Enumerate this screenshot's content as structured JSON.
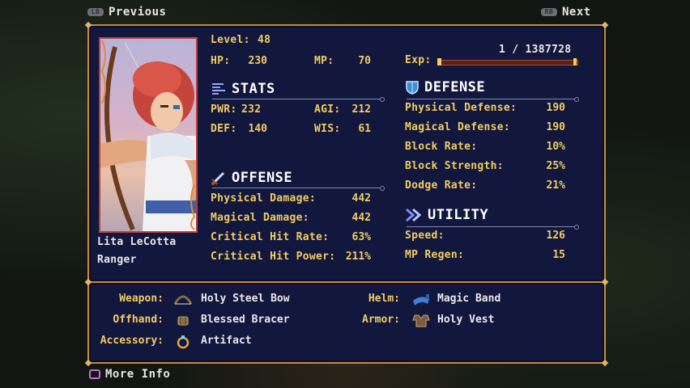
{
  "nav": {
    "prev_label": "Previous",
    "next_label": "Next",
    "prev_glyph": "LB",
    "next_glyph": "RB"
  },
  "character": {
    "name": "Lita LeCotta",
    "class": "Ranger",
    "level_label": "Level:",
    "level": "48",
    "hp_label": "HP:",
    "hp": "230",
    "mp_label": "MP:",
    "mp": "70",
    "exp_label": "Exp:",
    "exp": "1 / 1387728",
    "exp_fraction": 0.0
  },
  "stats": {
    "title": "STATS",
    "items": [
      {
        "label": "PWR:",
        "value": "232"
      },
      {
        "label": "AGI:",
        "value": "212"
      },
      {
        "label": "DEF:",
        "value": "140"
      },
      {
        "label": "WIS:",
        "value": "61"
      }
    ]
  },
  "offense": {
    "title": "OFFENSE",
    "items": [
      {
        "label": "Physical Damage:",
        "value": "442"
      },
      {
        "label": "Magical Damage:",
        "value": "442"
      },
      {
        "label": "Critical Hit Rate:",
        "value": "63%"
      },
      {
        "label": "Critical Hit Power:",
        "value": "211%"
      }
    ]
  },
  "defense": {
    "title": "DEFENSE",
    "items": [
      {
        "label": "Physical Defense:",
        "value": "190"
      },
      {
        "label": "Magical Defense:",
        "value": "190"
      },
      {
        "label": "Block Rate:",
        "value": "10%"
      },
      {
        "label": "Block Strength:",
        "value": "25%"
      },
      {
        "label": "Dodge Rate:",
        "value": "21%"
      }
    ]
  },
  "utility": {
    "title": "UTILITY",
    "items": [
      {
        "label": "Speed:",
        "value": "126"
      },
      {
        "label": "MP Regen:",
        "value": "15"
      }
    ]
  },
  "equipment": {
    "weapon": {
      "label": "Weapon:",
      "item": "Holy Steel Bow",
      "icon": "bow-icon"
    },
    "offhand": {
      "label": "Offhand:",
      "item": "Blessed Bracer",
      "icon": "bracer-icon"
    },
    "accessory": {
      "label": "Accessory:",
      "item": "Artifact",
      "icon": "ring-icon"
    },
    "helm": {
      "label": "Helm:",
      "item": "Magic Band",
      "icon": "band-icon"
    },
    "armor": {
      "label": "Armor:",
      "item": "Holy Vest",
      "icon": "vest-icon"
    }
  },
  "footer": {
    "more_info_label": "More Info"
  },
  "colors": {
    "accent_gold": "#f2cc62",
    "panel_bg": "#12173e",
    "border": "#c98a3c",
    "exp_bar": "#c0392b"
  }
}
